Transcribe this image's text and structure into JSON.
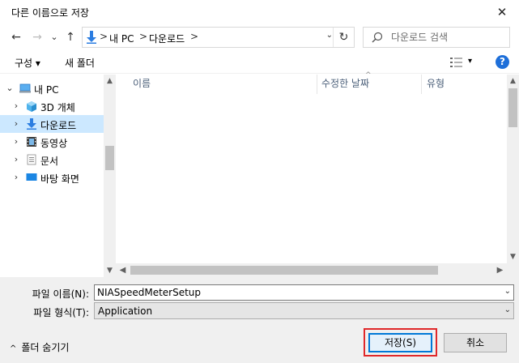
{
  "window": {
    "title": "다른 이름으로 저장",
    "close_glyph": "✕"
  },
  "nav": {
    "back_glyph": "←",
    "forward_glyph": "→",
    "recent_glyph": "⌄",
    "up_glyph": "↑",
    "breadcrumb": [
      "내 PC",
      "다운로드"
    ],
    "separator": ">",
    "dropdown_glyph": "⌄",
    "refresh_glyph": "↻",
    "search_placeholder": "다운로드 검색"
  },
  "toolbar": {
    "organize": "구성 ▾",
    "new_folder": "새 폴더",
    "help": "?",
    "view_dd": "▾"
  },
  "tree": {
    "expanded_glyph": "⌄",
    "collapsed_glyph": "›",
    "root": {
      "label": "내 PC"
    },
    "items": [
      {
        "label": "3D 개체",
        "icon": "cube-icon"
      },
      {
        "label": "다운로드",
        "icon": "download-icon",
        "selected": true
      },
      {
        "label": "동영상",
        "icon": "film-icon"
      },
      {
        "label": "문서",
        "icon": "document-icon"
      },
      {
        "label": "바탕 화면",
        "icon": "desktop-icon"
      }
    ]
  },
  "columns": [
    "이름",
    "수정한 날짜",
    "유형"
  ],
  "scroll": {
    "up": "▲",
    "down": "▼",
    "left": "◀",
    "right": "▶",
    "sort_caret": "^"
  },
  "form": {
    "filename_label": "파일 이름(N):",
    "filename_value": "NIASpeedMeterSetup",
    "filetype_label": "파일 형식(T):",
    "filetype_value": "Application",
    "dd": "⌄"
  },
  "footer": {
    "hide_folders": "폴더 숨기기",
    "hide_caret": "^",
    "save": "저장(S)",
    "cancel": "취소"
  },
  "colors": {
    "accent": "#0078d7",
    "highlight": "#e0282a",
    "selection": "#cce8ff"
  }
}
